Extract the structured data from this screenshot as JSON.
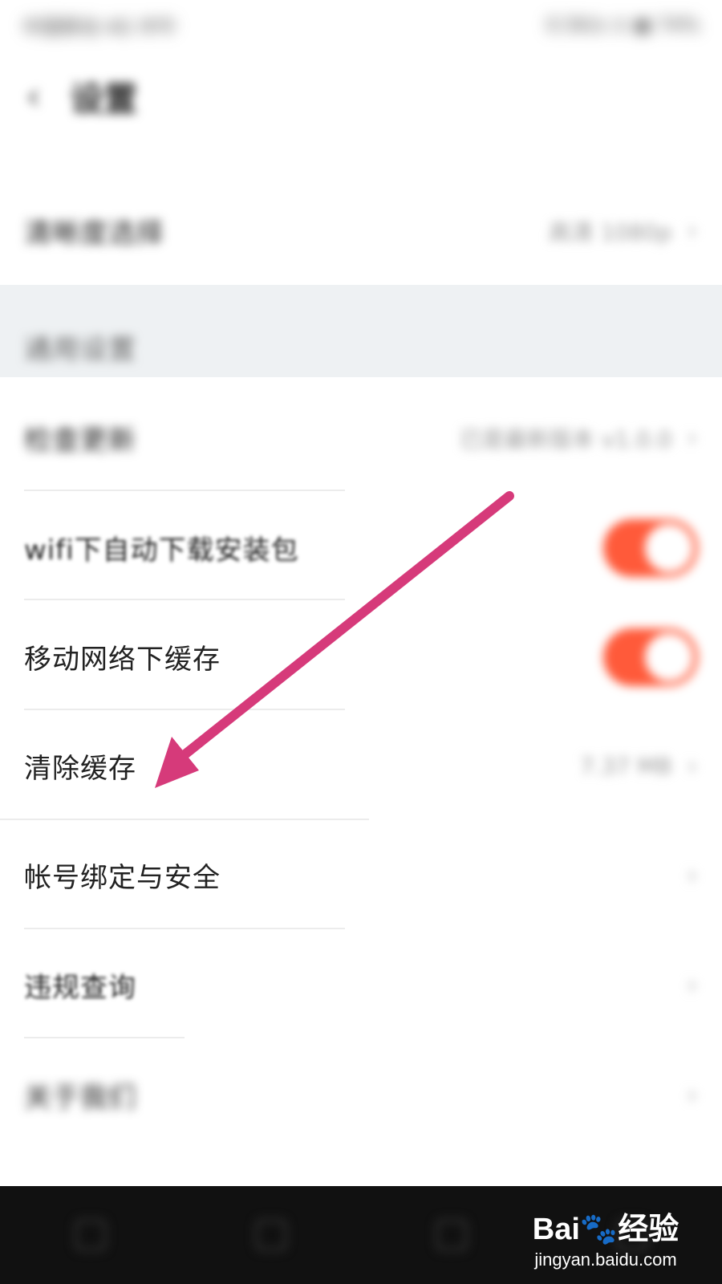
{
  "status_bar": {
    "left": "中国移动 4G 中午",
    "right": "0.5K/s ⊙ ◼ 74%"
  },
  "header": {
    "back_icon": "back-arrow-icon",
    "title": "设置"
  },
  "rows": [
    {
      "label": "清晰度选择",
      "value": "高清 1080p",
      "icon": "chevron-right-icon"
    },
    {
      "label": "通用设置",
      "section": true
    },
    {
      "label": "检查更新",
      "value": "已是最新版本 v1.0.0",
      "icon": "chevron-right-icon"
    },
    {
      "label": "wifi下自动下载安装包",
      "toggle": true,
      "on": true
    },
    {
      "label": "移动网络下缓存",
      "toggle": true,
      "on": true
    },
    {
      "label": "清除缓存",
      "value": "7.37 MB",
      "icon": "chevron-right-icon"
    },
    {
      "label": "帐号绑定与安全",
      "icon": "chevron-right-icon"
    },
    {
      "label": "违规查询",
      "icon": "chevron-right-icon"
    },
    {
      "label": "关于我们",
      "icon": "chevron-right-icon"
    }
  ],
  "watermark": {
    "brand": "Bai🐾经验",
    "url": "jingyan.baidu.com"
  },
  "colors": {
    "toggle_on": "#ff5a3a",
    "arrow": "#d63a7a",
    "section_bg": "#eef1f3"
  }
}
